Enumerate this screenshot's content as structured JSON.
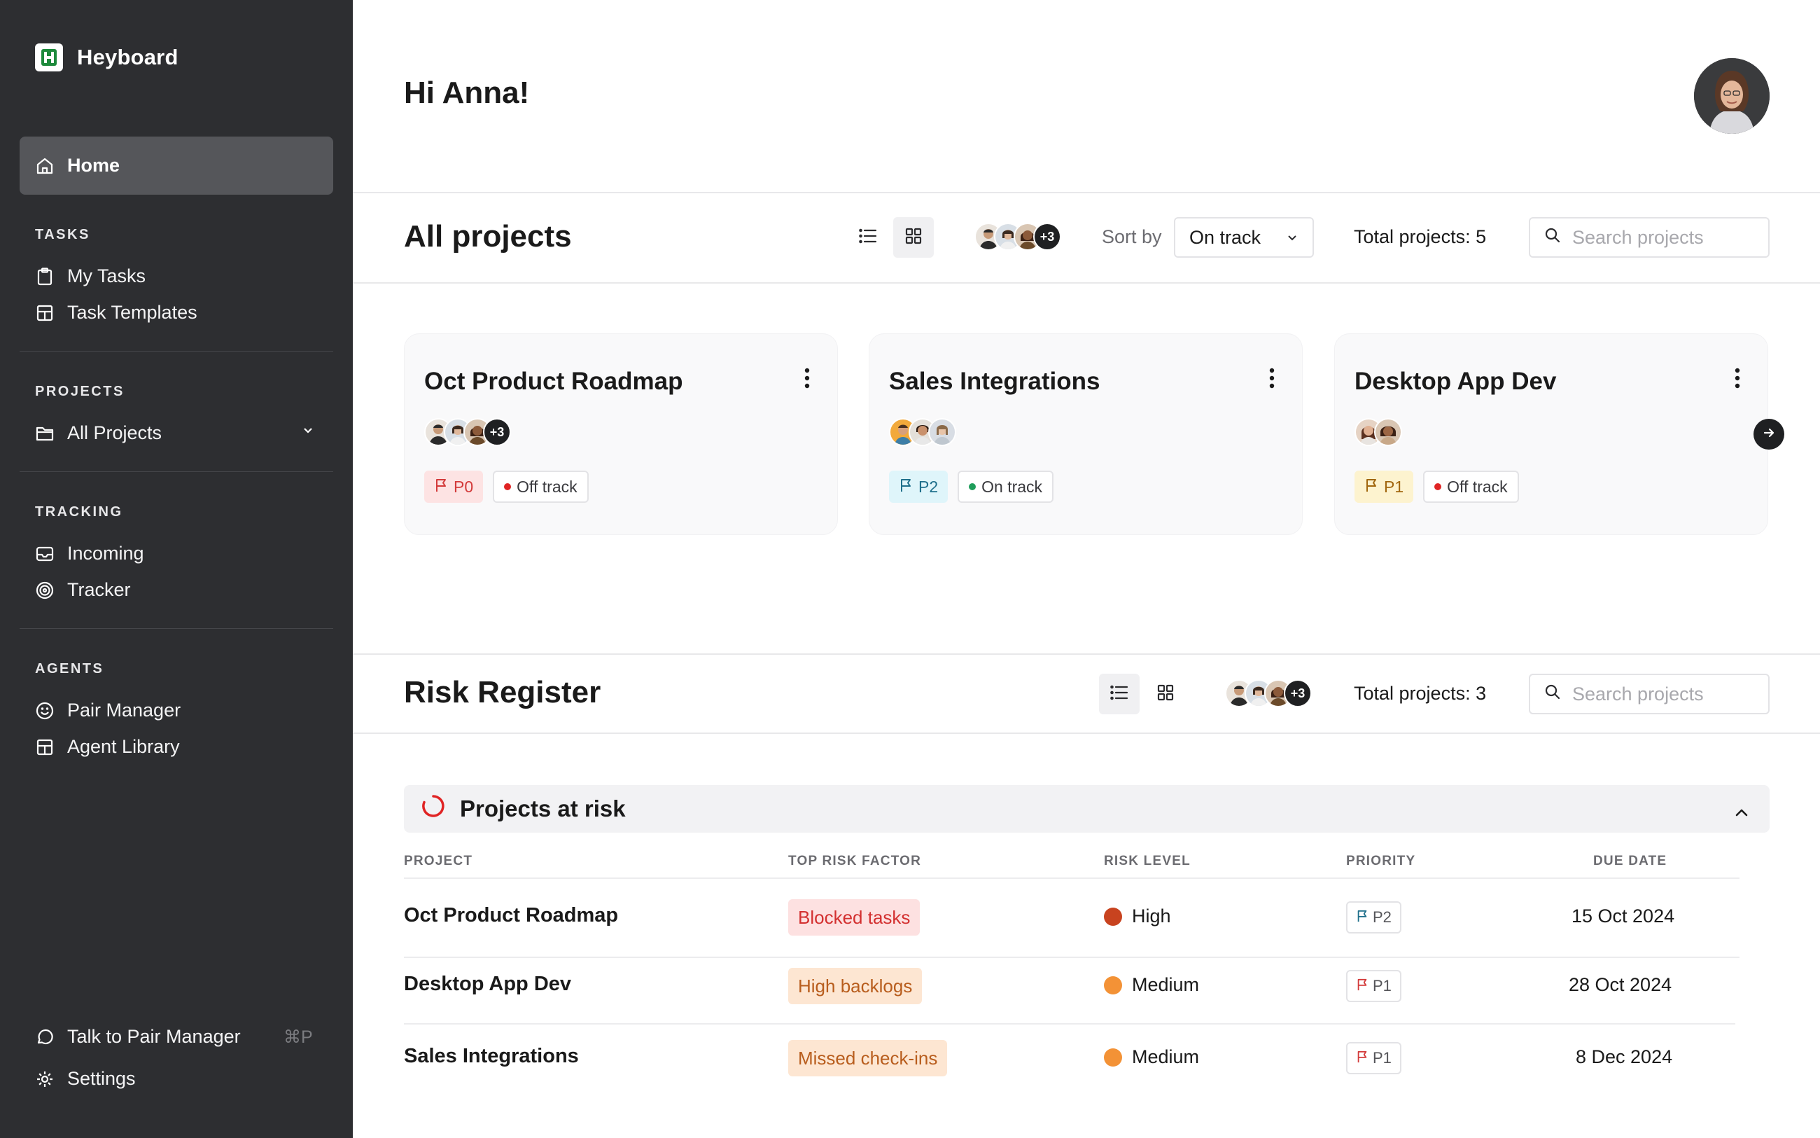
{
  "app": {
    "name": "Heyboard"
  },
  "sidebar": {
    "home": "Home",
    "sections": [
      {
        "title": "TASKS",
        "items": [
          "My Tasks",
          "Task Templates"
        ]
      },
      {
        "title": "PROJECTS",
        "items": [
          "All Projects"
        ]
      },
      {
        "title": "TRACKING",
        "items": [
          "Incoming",
          "Tracker"
        ]
      },
      {
        "title": "AGENTS",
        "items": [
          "Pair Manager",
          "Agent Library"
        ]
      }
    ],
    "footer": {
      "talk": "Talk to Pair Manager",
      "shortcut": "⌘P",
      "settings": "Settings"
    }
  },
  "header": {
    "greeting": "Hi Anna!"
  },
  "all_projects": {
    "title": "All projects",
    "avatars_more": "+3",
    "sort_label": "Sort by",
    "sort_value": "On track",
    "total": "Total projects: 5",
    "search_placeholder": "Search projects",
    "cards": [
      {
        "title": "Oct Product Roadmap",
        "more": "+3",
        "priority": "P0",
        "status": "Off track"
      },
      {
        "title": "Sales Integrations",
        "priority": "P2",
        "status": "On track"
      },
      {
        "title": "Desktop App Dev",
        "priority": "P1",
        "status": "Off track"
      }
    ]
  },
  "risk_register": {
    "title": "Risk Register",
    "avatars_more": "+3",
    "total": "Total projects: 3",
    "search_placeholder": "Search projects",
    "group_title": "Projects at risk",
    "columns": [
      "PROJECT",
      "TOP RISK FACTOR",
      "RISK LEVEL",
      "PRIORITY",
      "DUE DATE"
    ],
    "rows": [
      {
        "project": "Oct Product Roadmap",
        "factor": "Blocked tasks",
        "level": "High",
        "priority": "P2",
        "due": "15 Oct 2024"
      },
      {
        "project": "Desktop App Dev",
        "factor": "High backlogs",
        "level": "Medium",
        "priority": "P1",
        "due": "28 Oct 2024"
      },
      {
        "project": "Sales Integrations",
        "factor": "Missed check-ins",
        "level": "Medium",
        "priority": "P1",
        "due": "8 Dec 2024"
      }
    ]
  },
  "colors": {
    "sidebar_bg": "#2d2e31",
    "high": "#c8431f",
    "medium": "#f39236",
    "off_track": "#e02424",
    "on_track": "#1e9d5a",
    "brand_green": "#1e8a3c"
  },
  "icons": [
    "home-icon",
    "clipboard-icon",
    "template-icon",
    "folder-icon",
    "inbox-icon",
    "target-icon",
    "smile-icon",
    "library-icon",
    "chat-icon",
    "gear-icon",
    "list-view-icon",
    "grid-view-icon",
    "search-icon",
    "flag-icon",
    "kebab-menu-icon",
    "arrow-right-icon",
    "spinner-icon",
    "chevron-up-icon",
    "chevron-down-icon"
  ]
}
